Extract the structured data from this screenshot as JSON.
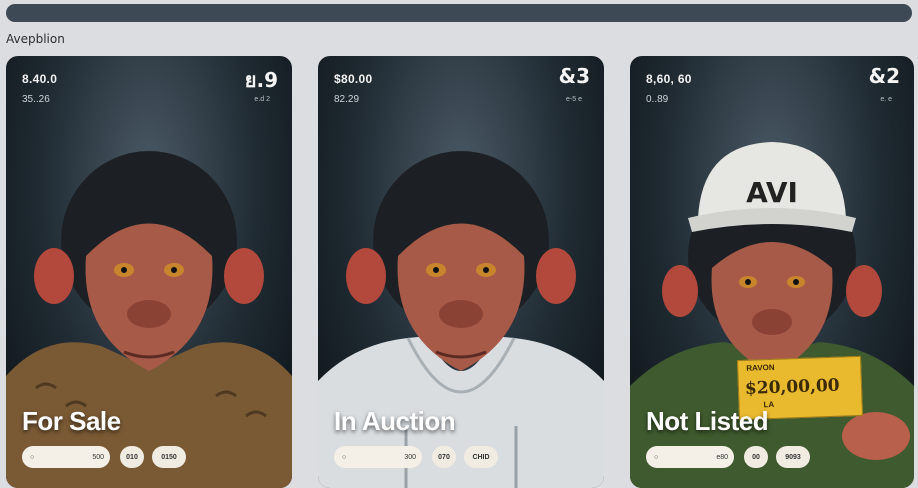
{
  "section_label": "Avepblion",
  "cards": [
    {
      "price": "8.40.0",
      "sub_price": "35..26",
      "rank": "ย.9",
      "meta": "e.d  2",
      "status": "For Sale",
      "input_value": "500",
      "pill_a": "010",
      "pill_b": "0150",
      "outfit_color": "#7a5a35"
    },
    {
      "price": "$80.00",
      "sub_price": "82.29",
      "rank": "&3",
      "meta": "e-5  e",
      "status": "In Auction",
      "input_value": "300",
      "pill_a": "070",
      "pill_b": "CHID",
      "outfit_color": "#d9dde0"
    },
    {
      "price": "8,60, 60",
      "sub_price": "0..89",
      "rank": "&2",
      "meta": "e.  e",
      "status": "Not Listed",
      "input_value": "e80",
      "pill_a": "00",
      "pill_b": "9093",
      "outfit_color": "#3f5a2e",
      "cap_text": "AVI",
      "ticket_label": "RAVON",
      "ticket_value": "$20,00,00",
      "ticket_foot": "LA"
    }
  ]
}
